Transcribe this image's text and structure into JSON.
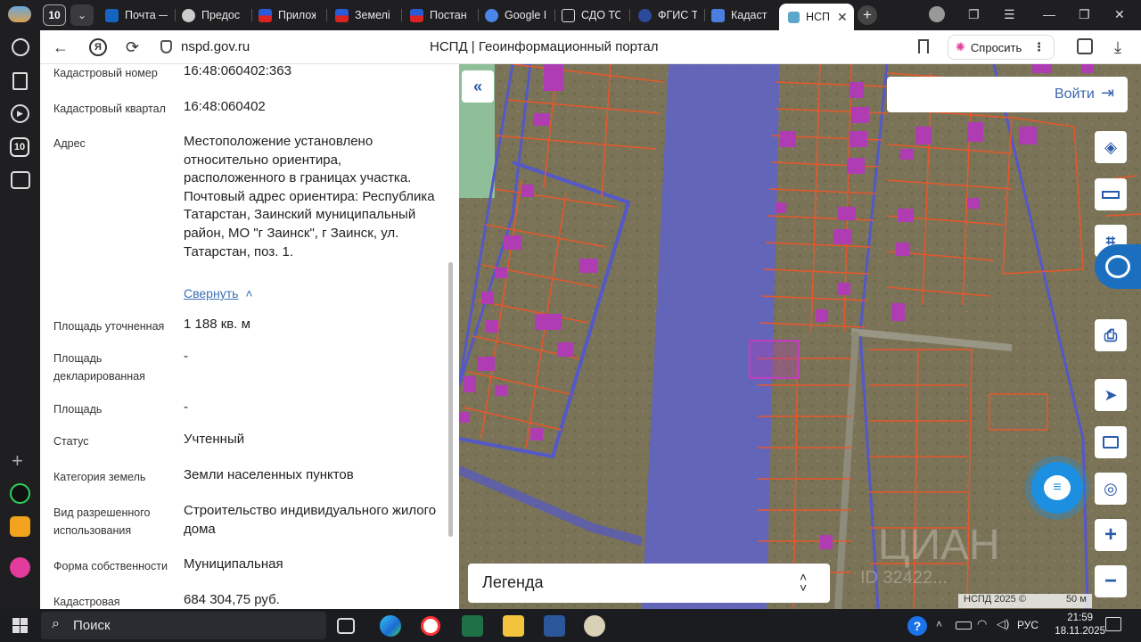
{
  "browser": {
    "tab_count_badge": "10",
    "tabs": [
      "Почта —",
      "Предос",
      "Прилож",
      "Земелі",
      "Постан",
      "Google I",
      "СДО ТО",
      "ФГИС Т",
      "Кадаст",
      "НСП"
    ],
    "url": "nspd.gov.ru",
    "page_title": "НСПД | Геоинформационный портал",
    "ask_label": "Спросить"
  },
  "rail": {
    "badge": "10"
  },
  "panel": {
    "fields": [
      {
        "label": "Кадастровый номер",
        "value": "16:48:060402:363"
      },
      {
        "label": "Кадастровый квартал",
        "value": "16:48:060402"
      },
      {
        "label": "Адрес",
        "value": "Местоположение установлено относительно ориентира, расположенного в границах участка. Почтовый адрес ориентира: Республика Татарстан, Заинский муниципальный район, МО \"г Заинск\", г Заинск, ул. Татарстан, поз. 1."
      },
      {
        "label": "Площадь уточненная",
        "value": "1 188 кв. м"
      },
      {
        "label": "Площадь декларированная",
        "value": "-"
      },
      {
        "label": "Площадь",
        "value": "-"
      },
      {
        "label": "Статус",
        "value": "Учтенный"
      },
      {
        "label": "Категория земель",
        "value": "Земли населенных пунктов"
      },
      {
        "label": "Вид разрешенного использования",
        "value": "Строительство индивидуального жилого дома"
      },
      {
        "label": "Форма собственности",
        "value": "Муниципальная"
      },
      {
        "label": "Кадастровая",
        "value": "684 304,75 руб."
      }
    ],
    "collapse_link": "Свернуть"
  },
  "map": {
    "login_label": "Войти",
    "legend_label": "Легенда",
    "attribution": "НСПД 2025 ©",
    "scale": "50 м",
    "watermark": "ЦИАН",
    "watermark_id": "ID 32422..."
  },
  "taskbar": {
    "search_placeholder": "Поиск",
    "lang": "РУС",
    "time": "21:59",
    "date": "18.11.2025"
  },
  "colors": {
    "accent": "#3b66b0",
    "parcel": "#e8572a",
    "selected": "#b03cb4",
    "water": "#5f63c9"
  }
}
